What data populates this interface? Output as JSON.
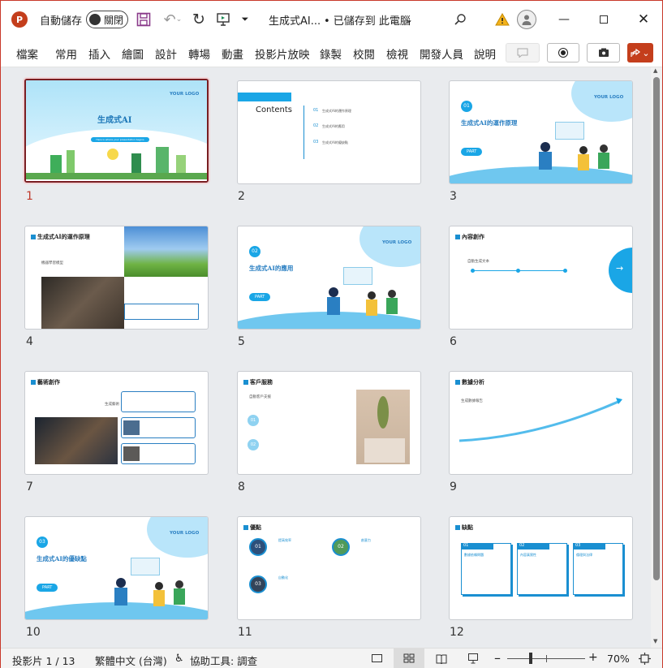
{
  "titlebar": {
    "autosave_label": "自動儲存",
    "autosave_state": "關閉",
    "doc_title": "生成式AI...",
    "save_status": "• 已儲存到 此電腦"
  },
  "ribbon": {
    "tabs": [
      "檔案",
      "常用",
      "插入",
      "繪圖",
      "設計",
      "轉場",
      "動畫",
      "投影片放映",
      "錄製",
      "校閱",
      "檢視",
      "開發人員",
      "說明"
    ]
  },
  "slides": [
    {
      "num": "1",
      "title": "生成式AI",
      "logo": "YOUR LOGO",
      "subtitle": "Here is where your presentation begins"
    },
    {
      "num": "2",
      "title": "Contents",
      "items": [
        "生成式AI的運作原理",
        "生成式AI的應用",
        "生成式AI的優缺點"
      ],
      "item_nums": [
        "01",
        "02",
        "03"
      ]
    },
    {
      "num": "3",
      "badge": "01",
      "title": "生成式AI的運作原理",
      "logo": "YOUR LOGO",
      "part": "PART"
    },
    {
      "num": "4",
      "title": "生成式AI的運作原理",
      "sub": "機器學習模型"
    },
    {
      "num": "5",
      "badge": "02",
      "title": "生成式AI的應用",
      "logo": "YOUR LOGO",
      "part": "PART"
    },
    {
      "num": "6",
      "title": "內容創作",
      "sub": "自動生成文本",
      "arrow": "→"
    },
    {
      "num": "7",
      "title": "藝術創作",
      "sub": "生成藝術"
    },
    {
      "num": "8",
      "title": "客戶服務",
      "sub": "自動客戶支援",
      "badges": [
        "01",
        "02"
      ]
    },
    {
      "num": "9",
      "title": "數據分析",
      "sub": "生成數據報告"
    },
    {
      "num": "10",
      "badge": "03",
      "title": "生成式AI的優缺點",
      "logo": "YOUR LOGO",
      "part": "PART"
    },
    {
      "num": "11",
      "title": "優點",
      "badges": [
        "01",
        "02",
        "03"
      ],
      "labels": [
        "提高效率",
        "創意力",
        "自動化"
      ]
    },
    {
      "num": "12",
      "title": "缺點",
      "badges": [
        "01",
        "02",
        "03"
      ],
      "labels": [
        "數據依賴問題",
        "內容真實性",
        "倫理與法律"
      ]
    }
  ],
  "statusbar": {
    "slide_info": "投影片 1 / 13",
    "language": "繁體中文 (台灣)",
    "accessibility": "協助工具: 調查",
    "zoom": "70%"
  },
  "colors": {
    "accent": "#c43e1c",
    "selection": "#7a1e22",
    "brand_blue": "#2a7fc2"
  }
}
